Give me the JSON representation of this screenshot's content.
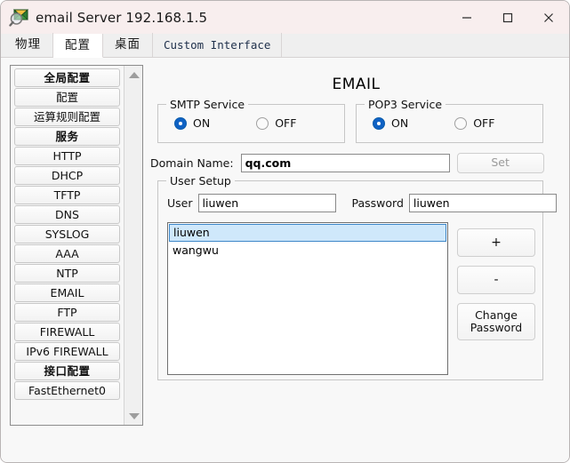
{
  "window": {
    "title": "email Server 192.168.1.5",
    "icon": "mail-magnifier-icon",
    "controls": {
      "minimize": "—",
      "maximize": "□",
      "close": "✕"
    }
  },
  "tabs": [
    {
      "label": "物理",
      "name": "tab-physical",
      "active": false,
      "style": "cn"
    },
    {
      "label": "配置",
      "name": "tab-config",
      "active": true,
      "style": "cn"
    },
    {
      "label": "桌面",
      "name": "tab-desktop",
      "active": false,
      "style": "cn"
    },
    {
      "label": "Custom Interface",
      "name": "tab-custom-interface",
      "active": false,
      "style": "custom"
    }
  ],
  "sidebar": {
    "items": [
      {
        "label": "全局配置",
        "name": "sidebar-item-global-settings",
        "header": true
      },
      {
        "label": "配置",
        "name": "sidebar-item-settings",
        "header": false
      },
      {
        "label": "运算规则配置",
        "name": "sidebar-item-algorithm-settings",
        "header": false
      },
      {
        "label": "服务",
        "name": "sidebar-item-services",
        "header": true
      },
      {
        "label": "HTTP",
        "name": "sidebar-item-http",
        "header": false
      },
      {
        "label": "DHCP",
        "name": "sidebar-item-dhcp",
        "header": false
      },
      {
        "label": "TFTP",
        "name": "sidebar-item-tftp",
        "header": false
      },
      {
        "label": "DNS",
        "name": "sidebar-item-dns",
        "header": false
      },
      {
        "label": "SYSLOG",
        "name": "sidebar-item-syslog",
        "header": false
      },
      {
        "label": "AAA",
        "name": "sidebar-item-aaa",
        "header": false
      },
      {
        "label": "NTP",
        "name": "sidebar-item-ntp",
        "header": false
      },
      {
        "label": "EMAIL",
        "name": "sidebar-item-email",
        "header": false
      },
      {
        "label": "FTP",
        "name": "sidebar-item-ftp",
        "header": false
      },
      {
        "label": "FIREWALL",
        "name": "sidebar-item-firewall",
        "header": false
      },
      {
        "label": "IPv6 FIREWALL",
        "name": "sidebar-item-ipv6-firewall",
        "header": false
      },
      {
        "label": "接口配置",
        "name": "sidebar-item-interface-settings",
        "header": true
      },
      {
        "label": "FastEthernet0",
        "name": "sidebar-item-fastethernet0",
        "header": false
      }
    ],
    "scrollbar": {
      "up": "scroll-up-arrow",
      "down": "scroll-down-arrow"
    }
  },
  "main": {
    "title": "EMAIL",
    "smtp": {
      "legend": "SMTP Service",
      "on_label": "ON",
      "off_label": "OFF",
      "selected": "ON"
    },
    "pop3": {
      "legend": "POP3 Service",
      "on_label": "ON",
      "off_label": "OFF",
      "selected": "ON"
    },
    "domain": {
      "label": "Domain Name:",
      "value": "qq.com",
      "placeholder": "",
      "set_button": "Set",
      "set_enabled": false
    },
    "user_setup": {
      "legend": "User Setup",
      "user_label": "User",
      "user_value": "liuwen",
      "password_label": "Password",
      "password_value": "liuwen",
      "users": [
        {
          "name": "liuwen",
          "selected": true
        },
        {
          "name": "wangwu",
          "selected": false
        }
      ],
      "add_button": "+",
      "remove_button": "-",
      "change_password_line1": "Change",
      "change_password_line2": "Password"
    }
  },
  "colors": {
    "titlebar": "#f8eeee",
    "accent_radio": "#0f62c4",
    "selection": "#cfe8fb",
    "selection_border": "#3d87c8"
  }
}
